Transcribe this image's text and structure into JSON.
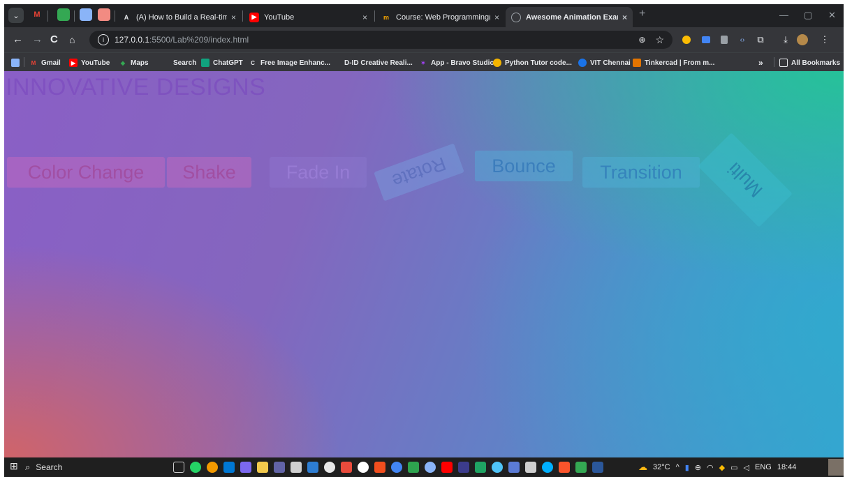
{
  "browser": {
    "tabs": [
      {
        "title": "(A) How to Build a Real-time Chat",
        "favicon": "A",
        "favicon_color": "#202124",
        "active": false
      },
      {
        "title": "YouTube",
        "favicon": "▶",
        "favicon_color": "#ff0000",
        "active": false
      },
      {
        "title": "Course: Web Programming(BC",
        "favicon": "m",
        "favicon_color": "#f4a300",
        "active": false
      },
      {
        "title": "Awesome Animation Example",
        "favicon": "◎",
        "favicon_color": "#5f6368",
        "active": true
      }
    ],
    "new_tab_label": "+",
    "url_host": "127.0.0.1",
    "url_path": ":5500/Lab%209/index.html",
    "bookmarks": [
      {
        "label": "Gmail",
        "icon": "gmail-icon",
        "color": "#ea4335"
      },
      {
        "label": "YouTube",
        "icon": "youtube-icon",
        "color": "#ff0000"
      },
      {
        "label": "Maps",
        "icon": "maps-icon",
        "color": "#34a853"
      },
      {
        "label": "Search",
        "icon": "search-icon",
        "color": "#35363a"
      },
      {
        "label": "ChatGPT",
        "icon": "chatgpt-icon",
        "color": "#10a37f"
      },
      {
        "label": "Free Image Enhanc...",
        "icon": "enhance-icon",
        "color": "#e8eaed"
      },
      {
        "label": "D-ID Creative Reali...",
        "icon": "did-icon",
        "color": "#35363a"
      },
      {
        "label": "App - Bravo Studio",
        "icon": "bravo-icon",
        "color": "#a142f4"
      },
      {
        "label": "Python Tutor code...",
        "icon": "python-icon",
        "color": "#f4b400"
      },
      {
        "label": "VIT Chennai",
        "icon": "vit-icon",
        "color": "#1a73e8"
      },
      {
        "label": "Tinkercad | From m...",
        "icon": "tinkercad-icon",
        "color": "#e37400"
      }
    ],
    "more_bookmarks": "»",
    "all_bookmarks": "All Bookmarks"
  },
  "page": {
    "title": "INNOVATIVE DESIGNS",
    "buttons": {
      "color_change": "Color Change",
      "shake": "Shake",
      "fade_in": "Fade In",
      "rotate": "Rotate",
      "bounce": "Bounce",
      "transition": "Transition",
      "multi": "Multi"
    }
  },
  "taskbar": {
    "search_label": "Search",
    "weather": "32°C",
    "language": "ENG",
    "time": "18:44"
  }
}
